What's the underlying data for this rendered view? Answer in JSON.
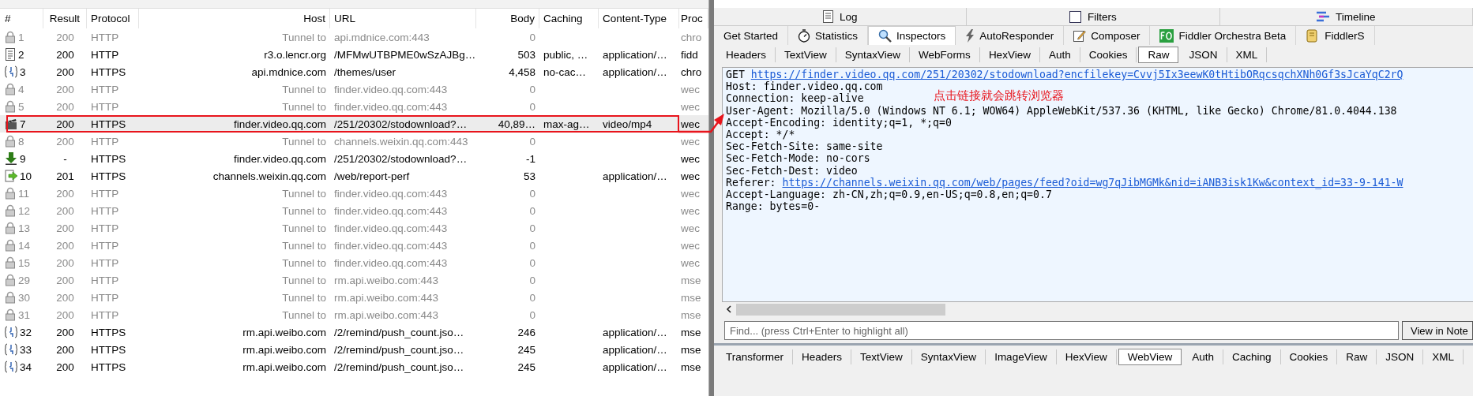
{
  "sessions": {
    "columns": [
      "#",
      "Result",
      "Protocol",
      "Host",
      "URL",
      "Body",
      "Caching",
      "Content-Type",
      "Proc"
    ],
    "rows": [
      {
        "kind": "lock",
        "num": "1",
        "result": "200",
        "protocol": "HTTP",
        "host": "Tunnel to",
        "url": "api.mdnice.com:443",
        "body": "0",
        "caching": "",
        "content_type": "",
        "process": "chro",
        "dim": true,
        "selected": false
      },
      {
        "kind": "doc",
        "num": "2",
        "result": "200",
        "protocol": "HTTP",
        "host": "r3.o.lencr.org",
        "url": "/MFMwUTBPME0wSzAJBg…",
        "body": "503",
        "caching": "public, …",
        "content_type": "application/…",
        "process": "fidd",
        "dim": false,
        "selected": false
      },
      {
        "kind": "js",
        "num": "3",
        "result": "200",
        "protocol": "HTTPS",
        "host": "api.mdnice.com",
        "url": "/themes/user",
        "body": "4,458",
        "caching": "no-cac…",
        "content_type": "application/…",
        "process": "chro",
        "dim": false,
        "selected": false
      },
      {
        "kind": "lock",
        "num": "4",
        "result": "200",
        "protocol": "HTTP",
        "host": "Tunnel to",
        "url": "finder.video.qq.com:443",
        "body": "0",
        "caching": "",
        "content_type": "",
        "process": "wec",
        "dim": true,
        "selected": false
      },
      {
        "kind": "lock",
        "num": "5",
        "result": "200",
        "protocol": "HTTP",
        "host": "Tunnel to",
        "url": "finder.video.qq.com:443",
        "body": "0",
        "caching": "",
        "content_type": "",
        "process": "wec",
        "dim": true,
        "selected": false
      },
      {
        "kind": "video",
        "num": "7",
        "result": "200",
        "protocol": "HTTPS",
        "host": "finder.video.qq.com",
        "url": "/251/20302/stodownload?…",
        "body": "40,89…",
        "caching": "max-ag…",
        "content_type": "video/mp4",
        "process": "wec",
        "dim": false,
        "selected": true
      },
      {
        "kind": "lock",
        "num": "8",
        "result": "200",
        "protocol": "HTTP",
        "host": "Tunnel to",
        "url": "channels.weixin.qq.com:443",
        "body": "0",
        "caching": "",
        "content_type": "",
        "process": "wec",
        "dim": true,
        "selected": false
      },
      {
        "kind": "download",
        "num": "9",
        "result": "-",
        "protocol": "HTTPS",
        "host": "finder.video.qq.com",
        "url": "/251/20302/stodownload?…",
        "body": "-1",
        "caching": "",
        "content_type": "",
        "process": "wec",
        "dim": false,
        "selected": false
      },
      {
        "kind": "post",
        "num": "10",
        "result": "201",
        "protocol": "HTTPS",
        "host": "channels.weixin.qq.com",
        "url": "/web/report-perf",
        "body": "53",
        "caching": "",
        "content_type": "application/…",
        "process": "wec",
        "dim": false,
        "selected": false
      },
      {
        "kind": "lock",
        "num": "11",
        "result": "200",
        "protocol": "HTTP",
        "host": "Tunnel to",
        "url": "finder.video.qq.com:443",
        "body": "0",
        "caching": "",
        "content_type": "",
        "process": "wec",
        "dim": true,
        "selected": false
      },
      {
        "kind": "lock",
        "num": "12",
        "result": "200",
        "protocol": "HTTP",
        "host": "Tunnel to",
        "url": "finder.video.qq.com:443",
        "body": "0",
        "caching": "",
        "content_type": "",
        "process": "wec",
        "dim": true,
        "selected": false
      },
      {
        "kind": "lock",
        "num": "13",
        "result": "200",
        "protocol": "HTTP",
        "host": "Tunnel to",
        "url": "finder.video.qq.com:443",
        "body": "0",
        "caching": "",
        "content_type": "",
        "process": "wec",
        "dim": true,
        "selected": false
      },
      {
        "kind": "lock",
        "num": "14",
        "result": "200",
        "protocol": "HTTP",
        "host": "Tunnel to",
        "url": "finder.video.qq.com:443",
        "body": "0",
        "caching": "",
        "content_type": "",
        "process": "wec",
        "dim": true,
        "selected": false
      },
      {
        "kind": "lock",
        "num": "15",
        "result": "200",
        "protocol": "HTTP",
        "host": "Tunnel to",
        "url": "finder.video.qq.com:443",
        "body": "0",
        "caching": "",
        "content_type": "",
        "process": "wec",
        "dim": true,
        "selected": false
      },
      {
        "kind": "lock",
        "num": "29",
        "result": "200",
        "protocol": "HTTP",
        "host": "Tunnel to",
        "url": "rm.api.weibo.com:443",
        "body": "0",
        "caching": "",
        "content_type": "",
        "process": "mse",
        "dim": true,
        "selected": false
      },
      {
        "kind": "lock",
        "num": "30",
        "result": "200",
        "protocol": "HTTP",
        "host": "Tunnel to",
        "url": "rm.api.weibo.com:443",
        "body": "0",
        "caching": "",
        "content_type": "",
        "process": "mse",
        "dim": true,
        "selected": false
      },
      {
        "kind": "lock",
        "num": "31",
        "result": "200",
        "protocol": "HTTP",
        "host": "Tunnel to",
        "url": "rm.api.weibo.com:443",
        "body": "0",
        "caching": "",
        "content_type": "",
        "process": "mse",
        "dim": true,
        "selected": false
      },
      {
        "kind": "js",
        "num": "32",
        "result": "200",
        "protocol": "HTTPS",
        "host": "rm.api.weibo.com",
        "url": "/2/remind/push_count.jso…",
        "body": "246",
        "caching": "",
        "content_type": "application/…",
        "process": "mse",
        "dim": false,
        "selected": false
      },
      {
        "kind": "js",
        "num": "33",
        "result": "200",
        "protocol": "HTTPS",
        "host": "rm.api.weibo.com",
        "url": "/2/remind/push_count.jso…",
        "body": "245",
        "caching": "",
        "content_type": "application/…",
        "process": "mse",
        "dim": false,
        "selected": false
      },
      {
        "kind": "js",
        "num": "34",
        "result": "200",
        "protocol": "HTTPS",
        "host": "rm.api.weibo.com",
        "url": "/2/remind/push_count.jso…",
        "body": "245",
        "caching": "",
        "content_type": "application/…",
        "process": "mse",
        "dim": false,
        "selected": false
      }
    ]
  },
  "top_tabs": [
    {
      "kind": "log",
      "label": "Log"
    },
    {
      "kind": "filters",
      "label": "Filters"
    },
    {
      "kind": "timeline",
      "label": "Timeline"
    }
  ],
  "main_tabs": [
    {
      "kind": "start",
      "label": "Get Started",
      "selected": false
    },
    {
      "kind": "stats",
      "label": "Statistics",
      "selected": false
    },
    {
      "kind": "inspect",
      "label": "Inspectors",
      "selected": true
    },
    {
      "kind": "bolt",
      "label": "AutoResponder",
      "selected": false
    },
    {
      "kind": "compose",
      "label": "Composer",
      "selected": false
    },
    {
      "kind": "fo",
      "label": "Fiddler Orchestra Beta",
      "selected": false
    },
    {
      "kind": "script",
      "label": "FiddlerS",
      "selected": false
    }
  ],
  "request_tabs": [
    {
      "label": "Headers",
      "selected": false
    },
    {
      "label": "TextView",
      "selected": false
    },
    {
      "label": "SyntaxView",
      "selected": false
    },
    {
      "label": "WebForms",
      "selected": false
    },
    {
      "label": "HexView",
      "selected": false
    },
    {
      "label": "Auth",
      "selected": false
    },
    {
      "label": "Cookies",
      "selected": false
    },
    {
      "label": "Raw",
      "selected": true
    },
    {
      "label": "JSON",
      "selected": false
    },
    {
      "label": "XML",
      "selected": false
    }
  ],
  "raw_lines": [
    {
      "text": "GET ",
      "link": "https://finder.video.qq.com/251/20302/stodownload?encfilekey=Cvvj5Ix3eewK0tHtibORqcsqchXNh0Gf3sJcaYqC2rQ"
    },
    {
      "text": "Host: finder.video.qq.com"
    },
    {
      "text": "Connection: keep-alive"
    },
    {
      "text": "User-Agent: Mozilla/5.0 (Windows NT 6.1; WOW64) AppleWebKit/537.36 (KHTML, like Gecko) Chrome/81.0.4044.138"
    },
    {
      "text": "Accept-Encoding: identity;q=1, *;q=0"
    },
    {
      "text": "Accept: */*"
    },
    {
      "text": "Sec-Fetch-Site: same-site"
    },
    {
      "text": "Sec-Fetch-Mode: no-cors"
    },
    {
      "text": "Sec-Fetch-Dest: video"
    },
    {
      "text": "Referer: ",
      "link": "https://channels.weixin.qq.com/web/pages/feed?oid=wg7qJibMGMk&nid=iANB3isk1Kw&context_id=33-9-141-W"
    },
    {
      "text": "Accept-Language: zh-CN,zh;q=0.9,en-US;q=0.8,en;q=0.7"
    },
    {
      "text": "Range: bytes=0-"
    }
  ],
  "annotation": "点击链接就会跳转浏览器",
  "find": {
    "placeholder": "Find... (press Ctrl+Enter to highlight all)",
    "button": "View in Note"
  },
  "response_tabs": [
    {
      "label": "Transformer",
      "selected": false
    },
    {
      "label": "Headers",
      "selected": false
    },
    {
      "label": "TextView",
      "selected": false
    },
    {
      "label": "SyntaxView",
      "selected": false
    },
    {
      "label": "ImageView",
      "selected": false
    },
    {
      "label": "HexView",
      "selected": false
    },
    {
      "label": "WebView",
      "selected": true
    },
    {
      "label": "Auth",
      "selected": false
    },
    {
      "label": "Caching",
      "selected": false
    },
    {
      "label": "Cookies",
      "selected": false
    },
    {
      "label": "Raw",
      "selected": false
    },
    {
      "label": "JSON",
      "selected": false
    },
    {
      "label": "XML",
      "selected": false
    }
  ]
}
